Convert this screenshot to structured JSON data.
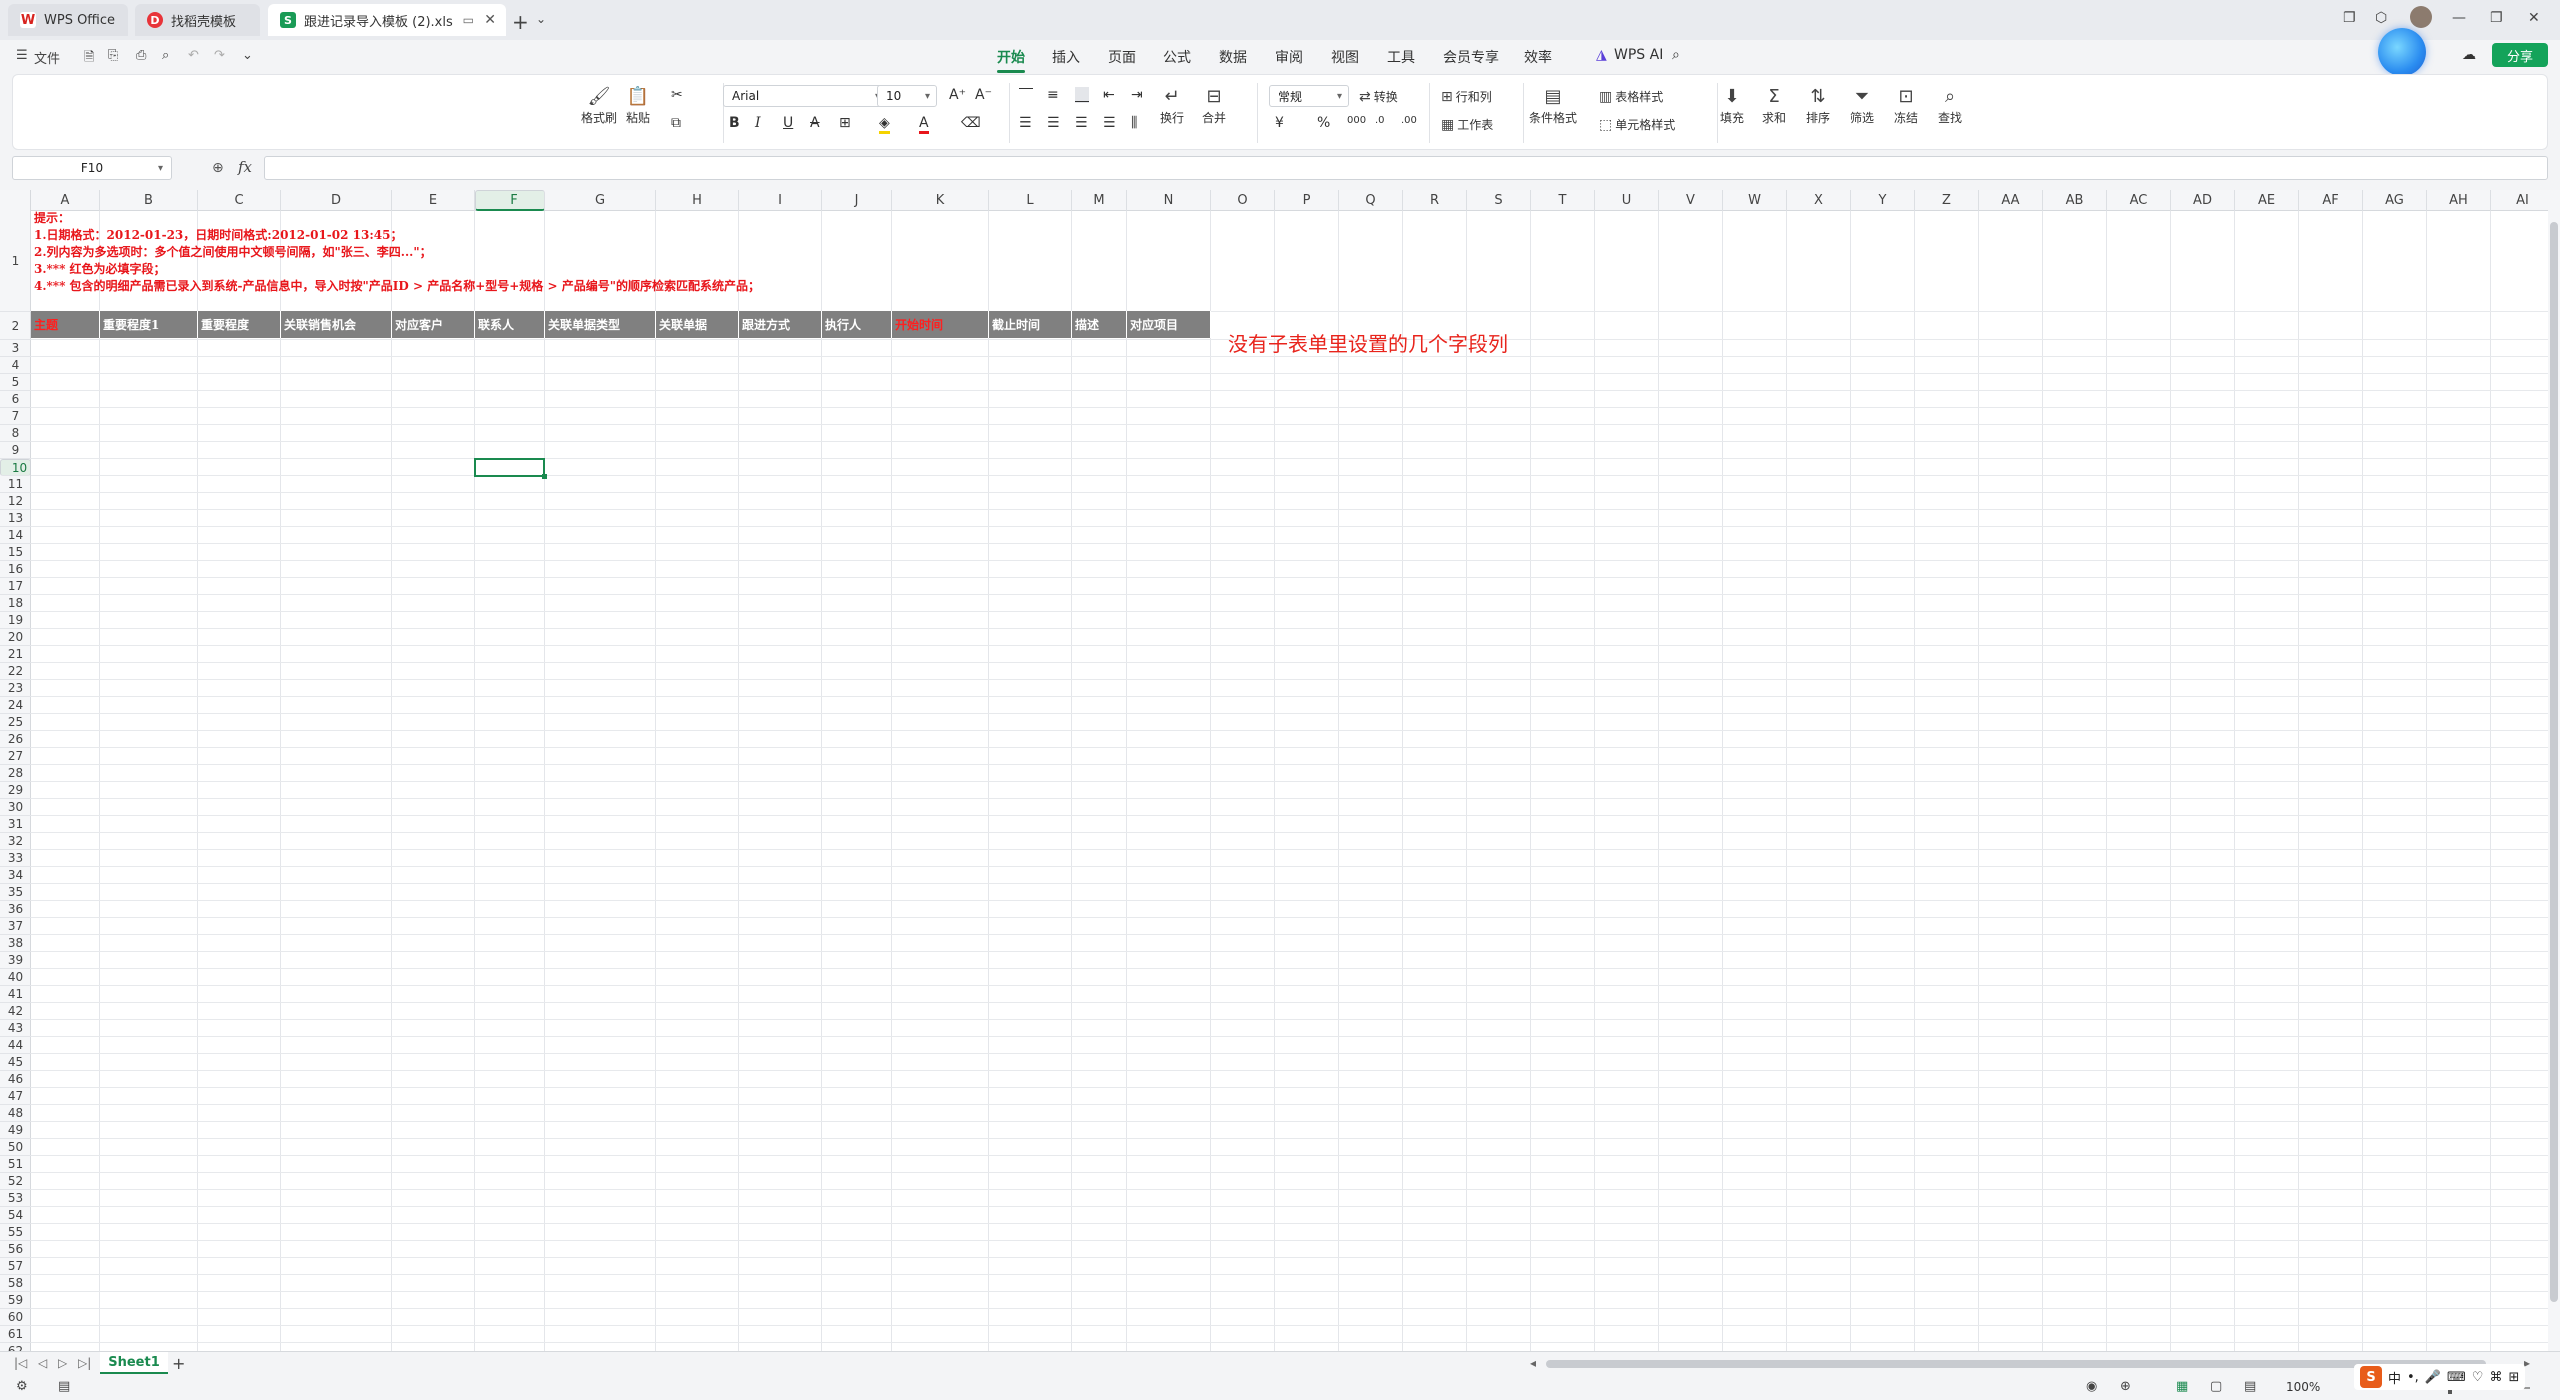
{
  "titlebar": {
    "tabs": [
      {
        "label": "WPS Office",
        "icon": "wps-logo-icon"
      },
      {
        "label": "找稻壳模板",
        "icon": "docer-icon"
      },
      {
        "label": "跟进记录导入模板 (2).xls",
        "icon": "spreadsheet-icon"
      }
    ]
  },
  "menubar": {
    "file": "文件",
    "tabs": [
      "开始",
      "插入",
      "页面",
      "公式",
      "数据",
      "审阅",
      "视图",
      "工具",
      "会员专享",
      "效率"
    ],
    "active_tab": "开始",
    "ai": "WPS AI",
    "share": "分享"
  },
  "ribbon": {
    "format_painter": "格式刷",
    "paste": "粘贴",
    "font_name": "Arial",
    "font_size": "10",
    "wrap": "换行",
    "merge": "合并",
    "number_format": "常规",
    "convert": "转换",
    "rows_cols": "行和列",
    "worksheet": "工作表",
    "conditional": "条件格式",
    "table_style": "表格样式",
    "cell_style": "单元格样式",
    "fill": "填充",
    "sum": "求和",
    "sort": "排序",
    "filter": "筛选",
    "freeze": "冻结",
    "find": "查找"
  },
  "formula_bar": {
    "name_box": "F10",
    "fx": "fx",
    "value": ""
  },
  "sheet": {
    "columns": [
      "A",
      "B",
      "C",
      "D",
      "E",
      "F",
      "G",
      "H",
      "I",
      "J",
      "K",
      "L",
      "M",
      "N",
      "O",
      "P",
      "Q",
      "R",
      "S",
      "T",
      "U",
      "V",
      "W",
      "X",
      "Y",
      "Z",
      "AA",
      "AB",
      "AC",
      "AD",
      "AE",
      "AF",
      "AG",
      "AH",
      "AI"
    ],
    "selected_col": "F",
    "selected_row": "10",
    "notes": [
      "提示：",
      "1.日期格式：2012-01-23，日期时间格式:2012-01-02 13:45；",
      "2.列内容为多选项时：多个值之间使用中文顿号间隔，如\"张三、李四...\"；",
      "3.*** 红色为必填字段；",
      "4.*** 包含的明细产品需已录入到系统-产品信息中，导入时按\"产品ID > 产品名称+型号+规格 > 产品编号\"的顺序检索匹配系统产品；"
    ],
    "headers": [
      {
        "text": "主题",
        "required": true
      },
      {
        "text": "重要程度1",
        "required": false
      },
      {
        "text": "重要程度",
        "required": false
      },
      {
        "text": "关联销售机会",
        "required": false
      },
      {
        "text": "对应客户",
        "required": false
      },
      {
        "text": "联系人",
        "required": false
      },
      {
        "text": "关联单据类型",
        "required": false
      },
      {
        "text": "关联单据",
        "required": false
      },
      {
        "text": "跟进方式",
        "required": false
      },
      {
        "text": "执行人",
        "required": false
      },
      {
        "text": "开始时间",
        "required": true
      },
      {
        "text": "截止时间",
        "required": false
      },
      {
        "text": "描述",
        "required": false
      },
      {
        "text": "对应项目",
        "required": false
      }
    ],
    "annotation": "没有子表单里设置的几个字段列",
    "required_color": "#ff1f1f",
    "header_bg": "#808080"
  },
  "sheet_tabs": {
    "active": "Sheet1"
  },
  "status": {
    "zoom": "100%"
  },
  "accent": "#1a8a4f"
}
